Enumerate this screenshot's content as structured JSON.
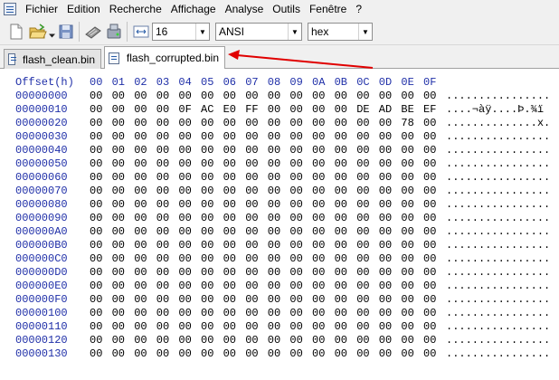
{
  "menu": {
    "items": [
      "Fichier",
      "Edition",
      "Recherche",
      "Affichage",
      "Analyse",
      "Outils",
      "Fenêtre",
      "?"
    ]
  },
  "toolbar": {
    "bytes_per_row": "16",
    "encoding": "ANSI",
    "display_mode": "hex"
  },
  "tabs": [
    {
      "label": "flash_clean.bin",
      "active": false
    },
    {
      "label": "flash_corrupted.bin",
      "active": true
    }
  ],
  "hex": {
    "offset_header": "Offset(h)",
    "column_headers": [
      "00",
      "01",
      "02",
      "03",
      "04",
      "05",
      "06",
      "07",
      "08",
      "09",
      "0A",
      "0B",
      "0C",
      "0D",
      "0E",
      "0F"
    ],
    "rows": [
      {
        "offset": "00000000",
        "bytes": [
          "00",
          "00",
          "00",
          "00",
          "00",
          "00",
          "00",
          "00",
          "00",
          "00",
          "00",
          "00",
          "00",
          "00",
          "00",
          "00"
        ],
        "ascii": "................"
      },
      {
        "offset": "00000010",
        "bytes": [
          "00",
          "00",
          "00",
          "00",
          "0F",
          "AC",
          "E0",
          "FF",
          "00",
          "00",
          "00",
          "00",
          "DE",
          "AD",
          "BE",
          "EF"
        ],
        "ascii": "....¬àÿ....Þ.¾ï"
      },
      {
        "offset": "00000020",
        "bytes": [
          "00",
          "00",
          "00",
          "00",
          "00",
          "00",
          "00",
          "00",
          "00",
          "00",
          "00",
          "00",
          "00",
          "00",
          "78",
          "00"
        ],
        "ascii": "..............x."
      },
      {
        "offset": "00000030",
        "bytes": [
          "00",
          "00",
          "00",
          "00",
          "00",
          "00",
          "00",
          "00",
          "00",
          "00",
          "00",
          "00",
          "00",
          "00",
          "00",
          "00"
        ],
        "ascii": "................"
      },
      {
        "offset": "00000040",
        "bytes": [
          "00",
          "00",
          "00",
          "00",
          "00",
          "00",
          "00",
          "00",
          "00",
          "00",
          "00",
          "00",
          "00",
          "00",
          "00",
          "00"
        ],
        "ascii": "................"
      },
      {
        "offset": "00000050",
        "bytes": [
          "00",
          "00",
          "00",
          "00",
          "00",
          "00",
          "00",
          "00",
          "00",
          "00",
          "00",
          "00",
          "00",
          "00",
          "00",
          "00"
        ],
        "ascii": "................"
      },
      {
        "offset": "00000060",
        "bytes": [
          "00",
          "00",
          "00",
          "00",
          "00",
          "00",
          "00",
          "00",
          "00",
          "00",
          "00",
          "00",
          "00",
          "00",
          "00",
          "00"
        ],
        "ascii": "................"
      },
      {
        "offset": "00000070",
        "bytes": [
          "00",
          "00",
          "00",
          "00",
          "00",
          "00",
          "00",
          "00",
          "00",
          "00",
          "00",
          "00",
          "00",
          "00",
          "00",
          "00"
        ],
        "ascii": "................"
      },
      {
        "offset": "00000080",
        "bytes": [
          "00",
          "00",
          "00",
          "00",
          "00",
          "00",
          "00",
          "00",
          "00",
          "00",
          "00",
          "00",
          "00",
          "00",
          "00",
          "00"
        ],
        "ascii": "................"
      },
      {
        "offset": "00000090",
        "bytes": [
          "00",
          "00",
          "00",
          "00",
          "00",
          "00",
          "00",
          "00",
          "00",
          "00",
          "00",
          "00",
          "00",
          "00",
          "00",
          "00"
        ],
        "ascii": "................"
      },
      {
        "offset": "000000A0",
        "bytes": [
          "00",
          "00",
          "00",
          "00",
          "00",
          "00",
          "00",
          "00",
          "00",
          "00",
          "00",
          "00",
          "00",
          "00",
          "00",
          "00"
        ],
        "ascii": "................"
      },
      {
        "offset": "000000B0",
        "bytes": [
          "00",
          "00",
          "00",
          "00",
          "00",
          "00",
          "00",
          "00",
          "00",
          "00",
          "00",
          "00",
          "00",
          "00",
          "00",
          "00"
        ],
        "ascii": "................"
      },
      {
        "offset": "000000C0",
        "bytes": [
          "00",
          "00",
          "00",
          "00",
          "00",
          "00",
          "00",
          "00",
          "00",
          "00",
          "00",
          "00",
          "00",
          "00",
          "00",
          "00"
        ],
        "ascii": "................"
      },
      {
        "offset": "000000D0",
        "bytes": [
          "00",
          "00",
          "00",
          "00",
          "00",
          "00",
          "00",
          "00",
          "00",
          "00",
          "00",
          "00",
          "00",
          "00",
          "00",
          "00"
        ],
        "ascii": "................"
      },
      {
        "offset": "000000E0",
        "bytes": [
          "00",
          "00",
          "00",
          "00",
          "00",
          "00",
          "00",
          "00",
          "00",
          "00",
          "00",
          "00",
          "00",
          "00",
          "00",
          "00"
        ],
        "ascii": "................"
      },
      {
        "offset": "000000F0",
        "bytes": [
          "00",
          "00",
          "00",
          "00",
          "00",
          "00",
          "00",
          "00",
          "00",
          "00",
          "00",
          "00",
          "00",
          "00",
          "00",
          "00"
        ],
        "ascii": "................"
      },
      {
        "offset": "00000100",
        "bytes": [
          "00",
          "00",
          "00",
          "00",
          "00",
          "00",
          "00",
          "00",
          "00",
          "00",
          "00",
          "00",
          "00",
          "00",
          "00",
          "00"
        ],
        "ascii": "................"
      },
      {
        "offset": "00000110",
        "bytes": [
          "00",
          "00",
          "00",
          "00",
          "00",
          "00",
          "00",
          "00",
          "00",
          "00",
          "00",
          "00",
          "00",
          "00",
          "00",
          "00"
        ],
        "ascii": "................"
      },
      {
        "offset": "00000120",
        "bytes": [
          "00",
          "00",
          "00",
          "00",
          "00",
          "00",
          "00",
          "00",
          "00",
          "00",
          "00",
          "00",
          "00",
          "00",
          "00",
          "00"
        ],
        "ascii": "................"
      },
      {
        "offset": "00000130",
        "bytes": [
          "00",
          "00",
          "00",
          "00",
          "00",
          "00",
          "00",
          "00",
          "00",
          "00",
          "00",
          "00",
          "00",
          "00",
          "00",
          "00"
        ],
        "ascii": "................"
      }
    ]
  },
  "colors": {
    "offset_blue": "#1f2fa8",
    "annotation_red": "#e00000"
  },
  "icons": {
    "toolbar": [
      "new-file-icon",
      "open-folder-icon",
      "dropdown-icon",
      "save-icon",
      "tape-icon",
      "disk-icon",
      "columns-icon"
    ]
  }
}
